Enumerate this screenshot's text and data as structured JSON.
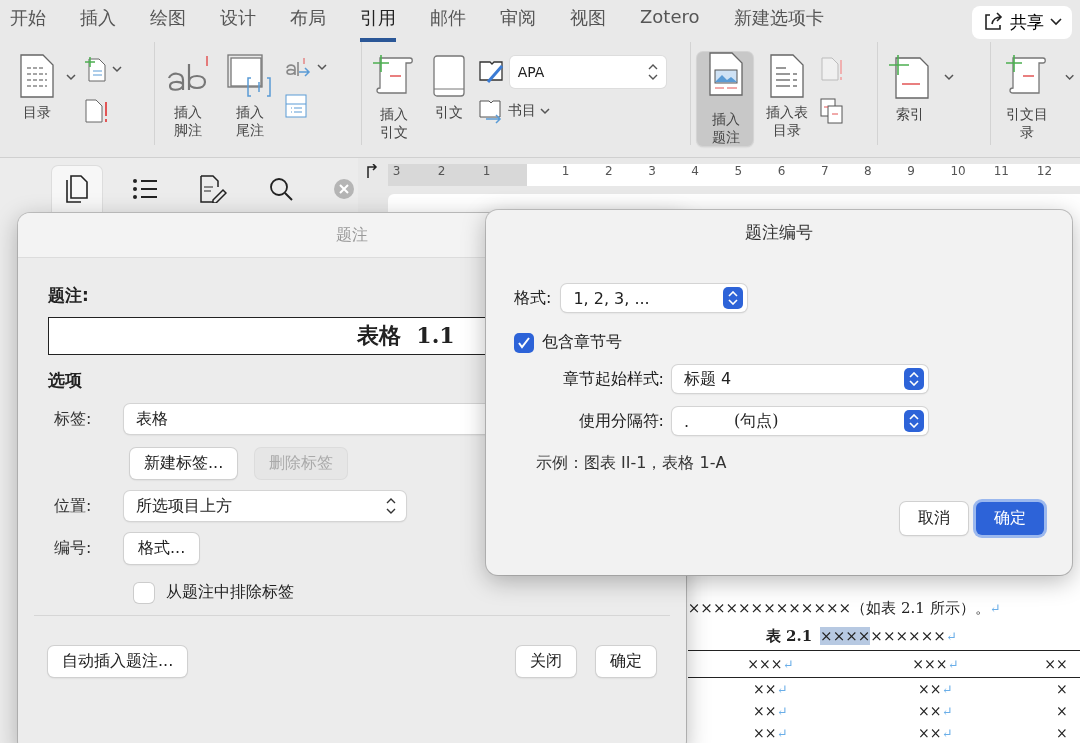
{
  "menu_tabs": [
    {
      "label": "开始",
      "selected": false
    },
    {
      "label": "插入",
      "selected": false
    },
    {
      "label": "绘图",
      "selected": false
    },
    {
      "label": "设计",
      "selected": false
    },
    {
      "label": "布局",
      "selected": false
    },
    {
      "label": "引用",
      "selected": true
    },
    {
      "label": "邮件",
      "selected": false
    },
    {
      "label": "审阅",
      "selected": false
    },
    {
      "label": "视图",
      "selected": false
    },
    {
      "label": "Zotero",
      "selected": false
    },
    {
      "label": "新建选项卡",
      "selected": false
    }
  ],
  "share_button": {
    "label": "共享"
  },
  "ribbon": {
    "toc": {
      "label": "目录"
    },
    "footnote": {
      "label": "插入脚注"
    },
    "endnote": {
      "label": "插入尾注"
    },
    "citation": {
      "label": "插入引文"
    },
    "citations": {
      "label": "引文"
    },
    "style_select": {
      "value": "APA"
    },
    "bibliography": {
      "label": "书目"
    },
    "caption": {
      "label": "插入题注",
      "selected": true
    },
    "table_of_figures": {
      "label": "插入表目录"
    },
    "index": {
      "label": "索引"
    },
    "table_of_authorities": {
      "label": "引文目录"
    }
  },
  "sidebar_tabs": [
    {
      "selected": true
    },
    {
      "selected": false
    },
    {
      "selected": false
    },
    {
      "selected": false
    }
  ],
  "ruler": {
    "left_marks": [
      "3",
      "2",
      "1"
    ],
    "right_marks": [
      "1",
      "2",
      "3",
      "4",
      "5",
      "6",
      "7",
      "8",
      "9",
      "10",
      "11",
      "12"
    ]
  },
  "document": {
    "paragraph": {
      "text": "×××××××××××××（如表 2.1 所示）。",
      "end_mark": "↵"
    },
    "caption": {
      "label": "表 2.1",
      "selected_text": "××××",
      "rest": "××××××",
      "end_mark": "↵"
    },
    "table": {
      "header": [
        {
          "text": "×××",
          "end_mark": "↵"
        },
        {
          "text": "×××",
          "end_mark": "↵"
        },
        {
          "text": "××"
        }
      ],
      "rows": [
        [
          {
            "text": "××",
            "end_mark": "↵"
          },
          {
            "text": "××",
            "end_mark": "↵"
          },
          {
            "text": "×"
          }
        ],
        [
          {
            "text": "××",
            "end_mark": "↵"
          },
          {
            "text": "××",
            "end_mark": "↵"
          },
          {
            "text": "×"
          }
        ],
        [
          {
            "text": "××",
            "end_mark": "↵"
          },
          {
            "text": "××",
            "end_mark": "↵"
          },
          {
            "text": "×"
          }
        ]
      ]
    }
  },
  "caption_dialog": {
    "title": "题注",
    "caption_label": "题注:",
    "caption_value": "表格  1.1",
    "options_heading": "选项",
    "label_label": "标签:",
    "label_value": "表格",
    "new_label_button": {
      "label": "新建标签...",
      "disabled": false
    },
    "delete_label_button": {
      "label": "删除标签",
      "disabled": true
    },
    "position_label": "位置:",
    "position_value": "所选项目上方",
    "numbering_label": "编号:",
    "format_button": "格式...",
    "exclude_label": {
      "label": "从题注中排除标签",
      "checked": false
    },
    "autocaption_button": "自动插入题注...",
    "close_button": "关闭",
    "ok_button": "确定"
  },
  "numbering_dialog": {
    "title": "题注编号",
    "format_label": "格式:",
    "format_value": "1, 2, 3, ...",
    "include_chapter": {
      "label": "包含章节号",
      "checked": true
    },
    "chapter_style_label": "章节起始样式:",
    "chapter_style_value": "标题 4",
    "separator_label": "使用分隔符:",
    "separator_value": ".",
    "separator_note": "(句点)",
    "example": "示例：图表 II-1，表格 1-A",
    "cancel_button": {
      "label": "取消",
      "default": false
    },
    "ok_button": {
      "label": "确定",
      "default": true
    }
  }
}
